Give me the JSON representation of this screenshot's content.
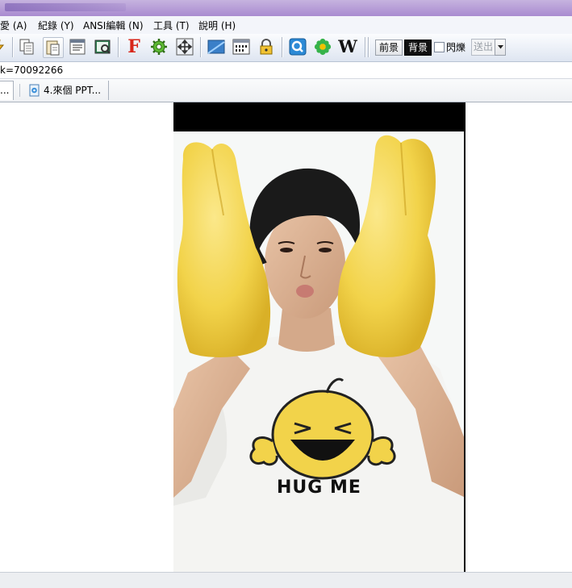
{
  "menubar": {
    "items": [
      "愛 (A)",
      "紀錄 (Y)",
      "ANSI編輯 (N)",
      "工具 (T)",
      "說明 (H)"
    ]
  },
  "toolbar": {
    "icons": [
      "lightning-icon",
      "copy-icon",
      "paste-icon",
      "ansi-copy-icon",
      "screenshot-icon",
      "font-icon",
      "gear-icon",
      "move-icon",
      "screen-icon",
      "binary-icon",
      "lock-icon",
      "quick-icon",
      "flower-icon",
      "wikipedia-icon"
    ],
    "wiki_letter": "W",
    "font_letter": "F",
    "foreground_label": "前景",
    "background_label": "背景",
    "blink_label": "閃爍",
    "send_label": "送出"
  },
  "address": {
    "text": "k=70092266"
  },
  "tabs": [
    {
      "label": "..."
    },
    {
      "label": "4.來個 PPT..."
    }
  ],
  "colors": {
    "titlebar": "#b39ad8",
    "toolbar": "#dee5f1",
    "photo_background": "#f6f8f7",
    "mitten_yellow": "#f2d34a"
  }
}
